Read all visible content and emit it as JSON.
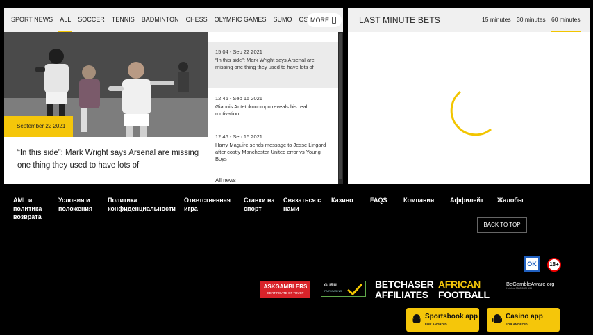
{
  "news": {
    "tabs": [
      {
        "label": "SPORT NEWS",
        "active": false
      },
      {
        "label": "ALL",
        "active": true
      },
      {
        "label": "SOCCER",
        "active": false
      },
      {
        "label": "TENNIS",
        "active": false
      },
      {
        "label": "BADMINTON",
        "active": false
      },
      {
        "label": "CHESS",
        "active": false
      },
      {
        "label": "OLYMPIC GAMES",
        "active": false
      },
      {
        "label": "SUMO",
        "active": false
      },
      {
        "label": "OSCAR",
        "active": false
      }
    ],
    "more_label": "MORE",
    "hero": {
      "date": "September 22 2021",
      "title": "“In this side”: Mark Wright says Arsenal are missing one thing they used to have lots of"
    },
    "side_items": [
      {
        "time": "15:04 - Sep 22 2021",
        "headline": "“In this side”: Mark Wright says Arsenal are missing one thing they used to have lots of"
      },
      {
        "time": "12:46 - Sep 15 2021",
        "headline": "Giannis Antetokounmpo reveals his real motivation"
      },
      {
        "time": "12:46 - Sep 15 2021",
        "headline": "Harry Maguire sends message to Jesse Lingard after costly Manchester United error vs Young Boys"
      }
    ],
    "all_news_label": "All news"
  },
  "bets": {
    "title": "LAST MINUTE BETS",
    "tabs": [
      {
        "label": "15 minutes",
        "active": false
      },
      {
        "label": "30 minutes",
        "active": false
      },
      {
        "label": "60 minutes",
        "active": true
      }
    ]
  },
  "footer": {
    "links": [
      "AML и политика возврата",
      "Условия и положения",
      "Политика конфиденциальности",
      "Ответственная игра",
      "Ставки на спорт",
      "Связаться с нами",
      "Казино",
      "FAQS",
      "Компания",
      "Аффилейт",
      "Жалобы"
    ],
    "back_to_top": "BACK TO TOP",
    "age_badge": "18+",
    "logos": {
      "askgamblers": "ASKGAMBLERS",
      "askgamblers_sub": "CERTIFICATE OF TRUST",
      "guru": "GURU",
      "guru_sub": "FAIR CASINO",
      "betchaser_1": "BETCHASER",
      "betchaser_2": "AFFILIATES",
      "african_1": "AFRICAN",
      "african_2": "FOOTBALL",
      "gamble_aware": "BeGambleAware.org",
      "gamble_aware_sub": "Helpline 0808 8020 133"
    },
    "apps": [
      {
        "label": "Sportsbook app",
        "sub": "FOR ANDROID"
      },
      {
        "label": "Casino app",
        "sub": "FOR ANDROID"
      }
    ]
  },
  "colors": {
    "accent": "#f5c60a",
    "background": "#000000",
    "panel": "#ffffff",
    "tab_bar": "#f0f0f0"
  }
}
